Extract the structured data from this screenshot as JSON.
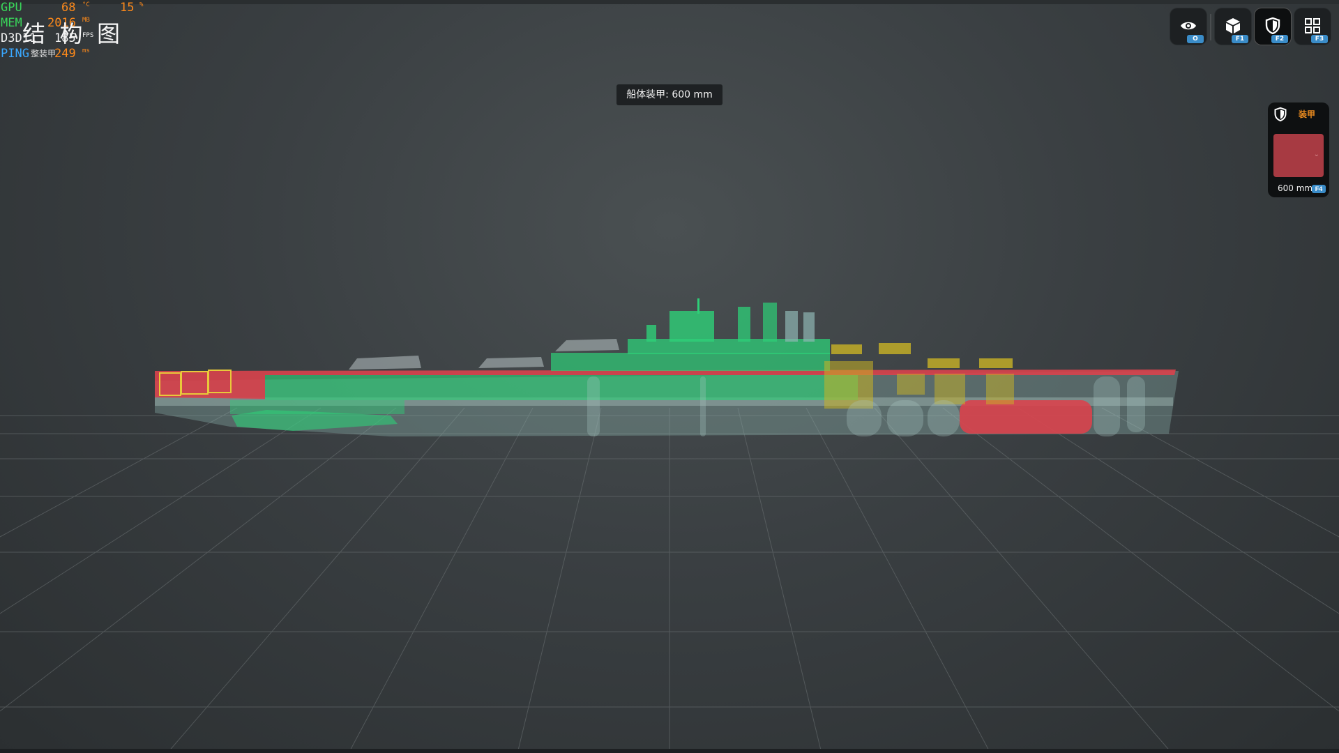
{
  "perf": {
    "gpu": {
      "label": "GPU",
      "value": "68",
      "unit": "°C",
      "value2": "15",
      "unit2": "%"
    },
    "mem": {
      "label": "MEM",
      "value": "2016",
      "unit": "MB"
    },
    "d3d": {
      "label": "D3D11",
      "value": "185",
      "unit": "FPS"
    },
    "ping": {
      "label": "PING",
      "value": "249",
      "unit": "ms"
    }
  },
  "page": {
    "title": "结 构 图",
    "subtitle": "整装甲"
  },
  "tooltip": {
    "text": "船体装甲: 600 mm"
  },
  "toolbar": {
    "buttons": [
      {
        "icon": "eye-icon",
        "key": "O",
        "active": false
      },
      {
        "icon": "cube-icon",
        "key": "F1",
        "active": false
      },
      {
        "icon": "shield-icon",
        "key": "F2",
        "active": true
      },
      {
        "icon": "grid-icon",
        "key": "F3",
        "active": false
      }
    ]
  },
  "armor_panel": {
    "title": "装甲",
    "value": "600 mm",
    "key": "F4",
    "color": "#a73a42"
  },
  "colors": {
    "armor_red": "#d9434c",
    "module_green": "#2ecf78",
    "ammo_yellow": "#c9b325",
    "hull_ghost": "#8fb7b3",
    "grid": "#6d7375"
  }
}
